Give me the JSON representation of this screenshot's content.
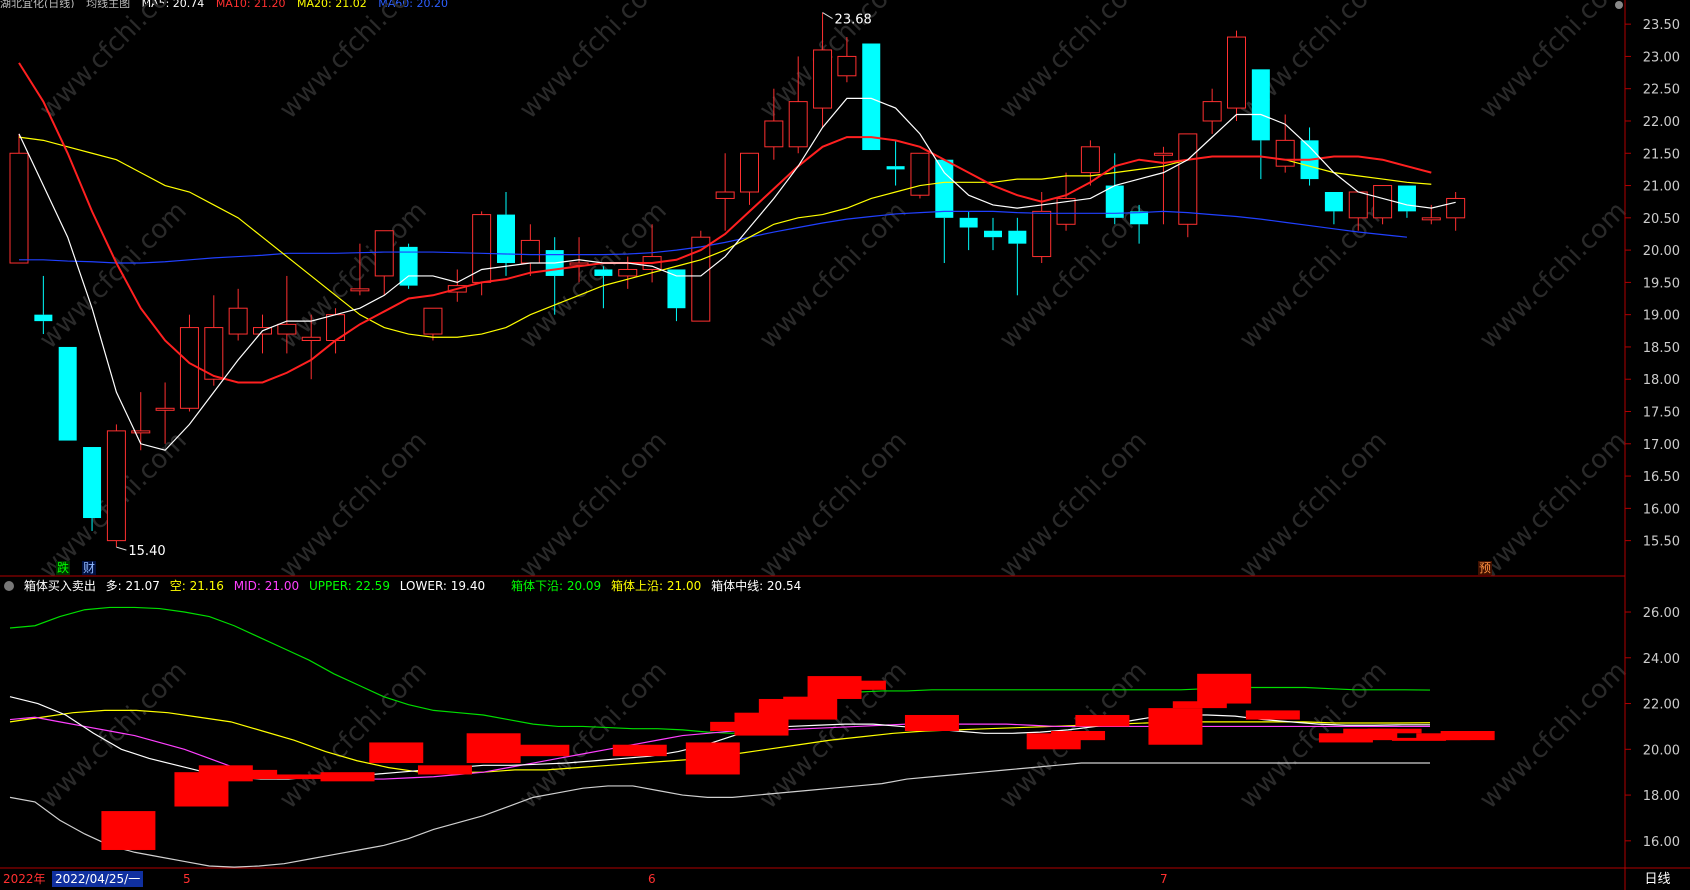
{
  "top_header": {
    "stock_name": "湖北宜化(日线)",
    "ma_indicator": "均线主图",
    "ma_values": [
      {
        "text": "MA5: 20.74",
        "color": "#ffffff"
      },
      {
        "text": "MA10: 21.20",
        "color": "#ff3030"
      },
      {
        "text": "MA20: 21.02",
        "color": "#ffff00"
      },
      {
        "text": "MA60: 20.20",
        "color": "#2d5fff"
      }
    ]
  },
  "price_axis": {
    "ticks": [
      "23.50",
      "23.00",
      "22.50",
      "22.00",
      "21.50",
      "21.00",
      "20.50",
      "20.00",
      "19.50",
      "19.00",
      "18.50",
      "18.00",
      "17.50",
      "17.00",
      "16.50",
      "16.00",
      "15.50"
    ]
  },
  "indicator_axis": {
    "ticks": [
      "26.00",
      "24.00",
      "22.00",
      "20.00",
      "18.00",
      "16.00"
    ]
  },
  "annotations": {
    "high_label": "23.68",
    "low_label": "15.40",
    "event_markers": [
      {
        "text": "跌",
        "color": "#00ff00",
        "bg": "#003300"
      },
      {
        "text": "财",
        "color": "#8fb8ff",
        "bg": "#001040"
      },
      {
        "text": "预",
        "color": "#ff9040",
        "bg": "#401000"
      }
    ]
  },
  "indicator_header": {
    "name": "箱体买入卖出",
    "items": [
      {
        "text": "多: 21.07",
        "color": "#ffffff"
      },
      {
        "text": "空: 21.16",
        "color": "#ffff00"
      },
      {
        "text": "MID: 21.00",
        "color": "#ff40ff"
      },
      {
        "text": "UPPER: 22.59",
        "color": "#00ff00"
      },
      {
        "text": "LOWER: 19.40",
        "color": "#ffffff"
      },
      {
        "text": "箱体下沿: 20.09",
        "color": "#00ff00"
      },
      {
        "text": "箱体上沿: 21.00",
        "color": "#ffff00"
      },
      {
        "text": "箱体中线: 20.54",
        "color": "#ffffff"
      }
    ]
  },
  "time_axis": {
    "year": "2022年",
    "cursor_date": "2022/04/25/一",
    "month_labels": [
      "5",
      "6",
      "7"
    ],
    "period": "日线"
  },
  "watermark": "www.cfchi.com",
  "colors": {
    "up": "#ff3030",
    "down": "#00ffff",
    "border": "#b00000",
    "ma5": "#ffffff",
    "ma10": "#ff2020",
    "ma20": "#ffff00",
    "ma60": "#2040ff",
    "upper": "#00dd00",
    "lower": "#d0d0d0",
    "mid": "#ff40ff"
  },
  "chart_data": {
    "type": "candlestick",
    "price_range": [
      15.2,
      23.75
    ],
    "candles": [
      {
        "o": 19.8,
        "h": 21.8,
        "l": 19.8,
        "c": 21.5
      },
      {
        "o": 19.0,
        "h": 19.6,
        "l": 18.7,
        "c": 18.9
      },
      {
        "o": 18.5,
        "h": 18.5,
        "l": 17.05,
        "c": 17.05
      },
      {
        "o": 16.95,
        "h": 16.95,
        "l": 15.65,
        "c": 15.85
      },
      {
        "o": 15.5,
        "h": 17.3,
        "l": 15.4,
        "c": 17.2
      },
      {
        "o": 17.2,
        "h": 17.8,
        "l": 16.9,
        "c": 17.2
      },
      {
        "o": 17.55,
        "h": 17.95,
        "l": 17.0,
        "c": 17.55
      },
      {
        "o": 17.55,
        "h": 19.0,
        "l": 17.5,
        "c": 18.8
      },
      {
        "o": 18.0,
        "h": 19.3,
        "l": 17.9,
        "c": 18.8
      },
      {
        "o": 18.7,
        "h": 19.4,
        "l": 18.6,
        "c": 19.1
      },
      {
        "o": 18.7,
        "h": 19.0,
        "l": 18.4,
        "c": 18.8
      },
      {
        "o": 18.7,
        "h": 19.6,
        "l": 18.4,
        "c": 18.85
      },
      {
        "o": 18.6,
        "h": 19.0,
        "l": 18.0,
        "c": 18.65
      },
      {
        "o": 18.6,
        "h": 19.1,
        "l": 18.4,
        "c": 19.0
      },
      {
        "o": 19.4,
        "h": 20.1,
        "l": 19.3,
        "c": 19.4
      },
      {
        "o": 19.6,
        "h": 20.3,
        "l": 19.3,
        "c": 20.3
      },
      {
        "o": 20.05,
        "h": 20.1,
        "l": 19.4,
        "c": 19.45
      },
      {
        "o": 18.7,
        "h": 19.1,
        "l": 18.6,
        "c": 19.1
      },
      {
        "o": 19.35,
        "h": 19.7,
        "l": 19.2,
        "c": 19.45
      },
      {
        "o": 19.5,
        "h": 20.6,
        "l": 19.3,
        "c": 20.55
      },
      {
        "o": 20.55,
        "h": 20.9,
        "l": 19.6,
        "c": 19.8
      },
      {
        "o": 19.8,
        "h": 20.4,
        "l": 19.6,
        "c": 20.15
      },
      {
        "o": 20.0,
        "h": 20.2,
        "l": 19.0,
        "c": 19.6
      },
      {
        "o": 19.8,
        "h": 20.2,
        "l": 19.5,
        "c": 19.8
      },
      {
        "o": 19.7,
        "h": 19.75,
        "l": 19.1,
        "c": 19.6
      },
      {
        "o": 19.6,
        "h": 19.9,
        "l": 19.4,
        "c": 19.7
      },
      {
        "o": 19.7,
        "h": 20.4,
        "l": 19.5,
        "c": 19.9
      },
      {
        "o": 19.7,
        "h": 19.7,
        "l": 18.9,
        "c": 19.1
      },
      {
        "o": 18.9,
        "h": 20.3,
        "l": 18.9,
        "c": 20.2
      },
      {
        "o": 20.8,
        "h": 21.5,
        "l": 20.3,
        "c": 20.9
      },
      {
        "o": 20.9,
        "h": 21.5,
        "l": 20.7,
        "c": 21.5
      },
      {
        "o": 21.6,
        "h": 22.5,
        "l": 21.4,
        "c": 22.0
      },
      {
        "o": 21.6,
        "h": 23.0,
        "l": 21.5,
        "c": 22.3
      },
      {
        "o": 22.2,
        "h": 23.68,
        "l": 21.9,
        "c": 23.1
      },
      {
        "o": 22.7,
        "h": 23.3,
        "l": 22.6,
        "c": 23.0
      },
      {
        "o": 23.2,
        "h": 23.2,
        "l": 21.6,
        "c": 21.55
      },
      {
        "o": 21.3,
        "h": 21.7,
        "l": 21.0,
        "c": 21.25
      },
      {
        "o": 20.85,
        "h": 21.5,
        "l": 20.8,
        "c": 21.5
      },
      {
        "o": 21.4,
        "h": 21.4,
        "l": 19.8,
        "c": 20.5
      },
      {
        "o": 20.5,
        "h": 20.6,
        "l": 20.0,
        "c": 20.35
      },
      {
        "o": 20.3,
        "h": 20.5,
        "l": 20.0,
        "c": 20.2
      },
      {
        "o": 20.3,
        "h": 20.5,
        "l": 19.3,
        "c": 20.1
      },
      {
        "o": 19.9,
        "h": 20.9,
        "l": 19.8,
        "c": 20.6
      },
      {
        "o": 20.4,
        "h": 21.2,
        "l": 20.3,
        "c": 20.8
      },
      {
        "o": 21.2,
        "h": 21.7,
        "l": 21.0,
        "c": 21.6
      },
      {
        "o": 21.0,
        "h": 21.5,
        "l": 20.4,
        "c": 20.5
      },
      {
        "o": 20.6,
        "h": 20.7,
        "l": 20.1,
        "c": 20.4
      },
      {
        "o": 21.5,
        "h": 21.6,
        "l": 20.4,
        "c": 21.5
      },
      {
        "o": 20.4,
        "h": 21.8,
        "l": 20.2,
        "c": 21.8
      },
      {
        "o": 22.0,
        "h": 22.5,
        "l": 21.8,
        "c": 22.3
      },
      {
        "o": 22.2,
        "h": 23.4,
        "l": 22.0,
        "c": 23.3
      },
      {
        "o": 22.8,
        "h": 22.8,
        "l": 21.1,
        "c": 21.7
      },
      {
        "o": 21.3,
        "h": 22.1,
        "l": 21.2,
        "c": 21.7
      },
      {
        "o": 21.7,
        "h": 21.9,
        "l": 21.0,
        "c": 21.1
      },
      {
        "o": 20.9,
        "h": 20.9,
        "l": 20.4,
        "c": 20.6
      },
      {
        "o": 20.5,
        "h": 20.9,
        "l": 20.3,
        "c": 20.9
      },
      {
        "o": 20.5,
        "h": 21.0,
        "l": 20.4,
        "c": 21.0
      },
      {
        "o": 21.0,
        "h": 21.0,
        "l": 20.5,
        "c": 20.6
      },
      {
        "o": 20.5,
        "h": 20.7,
        "l": 20.4,
        "c": 20.5
      },
      {
        "o": 20.5,
        "h": 20.9,
        "l": 20.3,
        "c": 20.8
      }
    ],
    "ma5": [
      21.8,
      21.0,
      20.2,
      19.1,
      17.8,
      17.0,
      16.9,
      17.3,
      17.8,
      18.3,
      18.75,
      18.9,
      18.9,
      19.0,
      19.1,
      19.3,
      19.6,
      19.6,
      19.5,
      19.7,
      19.75,
      19.8,
      19.8,
      19.85,
      19.8,
      19.8,
      19.75,
      19.6,
      19.6,
      19.9,
      20.35,
      20.8,
      21.3,
      21.9,
      22.35,
      22.35,
      22.2,
      21.8,
      21.2,
      20.85,
      20.7,
      20.65,
      20.7,
      20.75,
      20.8,
      21.0,
      21.1,
      21.2,
      21.4,
      21.75,
      22.1,
      22.1,
      21.95,
      21.6,
      21.2,
      20.9,
      20.8,
      20.7,
      20.65,
      20.74
    ],
    "ma10": [
      22.9,
      22.3,
      21.5,
      20.6,
      19.8,
      19.1,
      18.6,
      18.25,
      18.05,
      17.95,
      17.95,
      18.1,
      18.3,
      18.6,
      18.85,
      19.05,
      19.25,
      19.3,
      19.4,
      19.5,
      19.55,
      19.65,
      19.7,
      19.75,
      19.8,
      19.8,
      19.8,
      19.85,
      20.0,
      20.25,
      20.6,
      20.95,
      21.3,
      21.6,
      21.75,
      21.75,
      21.7,
      21.6,
      21.4,
      21.2,
      21.0,
      20.85,
      20.75,
      20.85,
      21.05,
      21.3,
      21.4,
      21.35,
      21.4,
      21.45,
      21.45,
      21.45,
      21.4,
      21.4,
      21.45,
      21.45,
      21.4,
      21.3,
      21.2
    ],
    "ma20": [
      21.75,
      21.7,
      21.6,
      21.5,
      21.4,
      21.2,
      21.0,
      20.9,
      20.7,
      20.5,
      20.2,
      19.9,
      19.6,
      19.3,
      19.0,
      18.8,
      18.7,
      18.65,
      18.65,
      18.7,
      18.8,
      19.0,
      19.15,
      19.3,
      19.45,
      19.55,
      19.65,
      19.75,
      19.85,
      20.0,
      20.2,
      20.4,
      20.5,
      20.55,
      20.65,
      20.8,
      20.9,
      21.0,
      21.05,
      21.05,
      21.05,
      21.1,
      21.1,
      21.15,
      21.15,
      21.2,
      21.25,
      21.3,
      21.4,
      21.45,
      21.45,
      21.45,
      21.4,
      21.3,
      21.2,
      21.15,
      21.1,
      21.05,
      21.02
    ],
    "ma60": [
      19.85,
      19.85,
      19.83,
      19.82,
      19.8,
      19.8,
      19.82,
      19.85,
      19.88,
      19.9,
      19.92,
      19.95,
      19.95,
      19.95,
      19.96,
      19.97,
      19.97,
      19.97,
      19.96,
      19.95,
      19.94,
      19.93,
      19.93,
      19.93,
      19.93,
      19.94,
      19.96,
      20.0,
      20.05,
      20.12,
      20.2,
      20.28,
      20.35,
      20.42,
      20.48,
      20.52,
      20.56,
      20.58,
      20.6,
      20.6,
      20.6,
      20.58,
      20.57,
      20.57,
      20.57,
      20.57,
      20.58,
      20.6,
      20.58,
      20.55,
      20.52,
      20.48,
      20.43,
      20.38,
      20.33,
      20.28,
      20.24,
      20.2
    ],
    "indicator": {
      "range": [
        14.9,
        26.7
      ],
      "upper": [
        25.3,
        25.4,
        25.8,
        26.1,
        26.2,
        26.2,
        26.15,
        26.0,
        25.8,
        25.4,
        24.9,
        24.4,
        23.9,
        23.3,
        22.8,
        22.3,
        21.95,
        21.7,
        21.6,
        21.5,
        21.3,
        21.1,
        21.0,
        21.0,
        20.95,
        20.9,
        20.9,
        20.85,
        20.75,
        20.7,
        20.8,
        21.3,
        22.0,
        22.4,
        22.5,
        22.55,
        22.55,
        22.6,
        22.6,
        22.6,
        22.6,
        22.6,
        22.6,
        22.6,
        22.6,
        22.6,
        22.6,
        22.6,
        22.65,
        22.7,
        22.7,
        22.7,
        22.7,
        22.65,
        22.6,
        22.6,
        22.6,
        22.59
      ],
      "lower": [
        17.9,
        17.7,
        16.9,
        16.3,
        15.8,
        15.5,
        15.3,
        15.1,
        14.9,
        14.85,
        14.9,
        15.0,
        15.2,
        15.4,
        15.6,
        15.8,
        16.1,
        16.5,
        16.8,
        17.1,
        17.5,
        17.9,
        18.1,
        18.3,
        18.4,
        18.4,
        18.2,
        18.0,
        17.9,
        17.9,
        18.0,
        18.1,
        18.2,
        18.3,
        18.4,
        18.5,
        18.7,
        18.8,
        18.9,
        19.0,
        19.1,
        19.2,
        19.3,
        19.4,
        19.4,
        19.4,
        19.4,
        19.4,
        19.4,
        19.4,
        19.4,
        19.4,
        19.4,
        19.4,
        19.4,
        19.4,
        19.4,
        19.4
      ],
      "mid": [
        21.3,
        21.4,
        21.2,
        21.0,
        20.8,
        20.6,
        20.3,
        20.0,
        19.6,
        19.2,
        18.9,
        18.8,
        18.8,
        18.75,
        18.7,
        18.7,
        18.75,
        18.8,
        18.9,
        19.0,
        19.2,
        19.4,
        19.6,
        19.8,
        20.0,
        20.2,
        20.4,
        20.6,
        20.7,
        20.8,
        20.85,
        20.85,
        20.9,
        20.95,
        21.0,
        21.05,
        21.1,
        21.1,
        21.1,
        21.1,
        21.1,
        21.05,
        21.0,
        21.0,
        21.0,
        21.0,
        21.0,
        21.0,
        21.0,
        21.0,
        21.0,
        21.0,
        21.0,
        21.0,
        21.0,
        21.0,
        21.0,
        21.0
      ],
      "duo": [
        22.3,
        22.0,
        21.5,
        20.7,
        20.0,
        19.6,
        19.3,
        19.0,
        18.8,
        18.7,
        18.7,
        18.8,
        18.9,
        18.9,
        19.0,
        19.1,
        19.2,
        19.3,
        19.3,
        19.35,
        19.4,
        19.5,
        19.6,
        19.7,
        19.9,
        20.2,
        20.6,
        20.9,
        21.0,
        21.05,
        21.1,
        21.1,
        21.0,
        20.9,
        20.8,
        20.7,
        20.7,
        20.75,
        20.85,
        21.0,
        21.2,
        21.4,
        21.5,
        21.5,
        21.45,
        21.3,
        21.2,
        21.1,
        21.05,
        21.05,
        21.07,
        21.07
      ],
      "kong": [
        21.2,
        21.4,
        21.6,
        21.7,
        21.7,
        21.6,
        21.4,
        21.2,
        20.8,
        20.4,
        19.9,
        19.5,
        19.2,
        19.0,
        19.0,
        19.0,
        19.1,
        19.1,
        19.2,
        19.3,
        19.4,
        19.5,
        19.6,
        19.8,
        20.0,
        20.2,
        20.4,
        20.55,
        20.7,
        20.8,
        20.85,
        20.9,
        20.95,
        21.0,
        21.05,
        21.1,
        21.15,
        21.2,
        21.2,
        21.2,
        21.2,
        21.2,
        21.15,
        21.15,
        21.15,
        21.16
      ],
      "boxes": [
        {
          "i": 4,
          "lo": 15.6,
          "hi": 17.3
        },
        {
          "i": 7,
          "lo": 17.5,
          "hi": 19.0
        },
        {
          "i": 8,
          "lo": 18.6,
          "hi": 19.3
        },
        {
          "i": 9,
          "lo": 18.7,
          "hi": 19.1
        },
        {
          "i": 10,
          "lo": 18.7,
          "hi": 18.9
        },
        {
          "i": 12,
          "lo": 18.7,
          "hi": 18.9
        },
        {
          "i": 13,
          "lo": 18.6,
          "hi": 19.0
        },
        {
          "i": 15,
          "lo": 19.4,
          "hi": 20.3
        },
        {
          "i": 17,
          "lo": 18.9,
          "hi": 19.3
        },
        {
          "i": 19,
          "lo": 19.4,
          "hi": 20.7
        },
        {
          "i": 21,
          "lo": 19.7,
          "hi": 20.2
        },
        {
          "i": 25,
          "lo": 19.7,
          "hi": 20.2
        },
        {
          "i": 28,
          "lo": 18.9,
          "hi": 20.3
        },
        {
          "i": 29,
          "lo": 20.8,
          "hi": 21.2
        },
        {
          "i": 30,
          "lo": 20.6,
          "hi": 21.6
        },
        {
          "i": 31,
          "lo": 21.5,
          "hi": 22.2
        },
        {
          "i": 32,
          "lo": 21.3,
          "hi": 22.3
        },
        {
          "i": 33,
          "lo": 22.2,
          "hi": 23.2
        },
        {
          "i": 34,
          "lo": 22.6,
          "hi": 23.0
        },
        {
          "i": 37,
          "lo": 20.8,
          "hi": 21.5
        },
        {
          "i": 42,
          "lo": 20.0,
          "hi": 20.7
        },
        {
          "i": 43,
          "lo": 20.4,
          "hi": 20.8
        },
        {
          "i": 44,
          "lo": 21.0,
          "hi": 21.5
        },
        {
          "i": 47,
          "lo": 20.2,
          "hi": 21.8
        },
        {
          "i": 48,
          "lo": 21.8,
          "hi": 22.1
        },
        {
          "i": 49,
          "lo": 22.0,
          "hi": 23.3
        },
        {
          "i": 51,
          "lo": 21.3,
          "hi": 21.7
        },
        {
          "i": 54,
          "lo": 20.3,
          "hi": 20.7
        },
        {
          "i": 55,
          "lo": 20.4,
          "hi": 20.9
        },
        {
          "i": 56,
          "lo": 20.7,
          "hi": 20.9
        },
        {
          "i": 57,
          "lo": 20.4,
          "hi": 20.5
        },
        {
          "i": 58,
          "lo": 20.4,
          "hi": 20.7
        },
        {
          "i": 59,
          "lo": 20.4,
          "hi": 20.8
        }
      ]
    }
  }
}
